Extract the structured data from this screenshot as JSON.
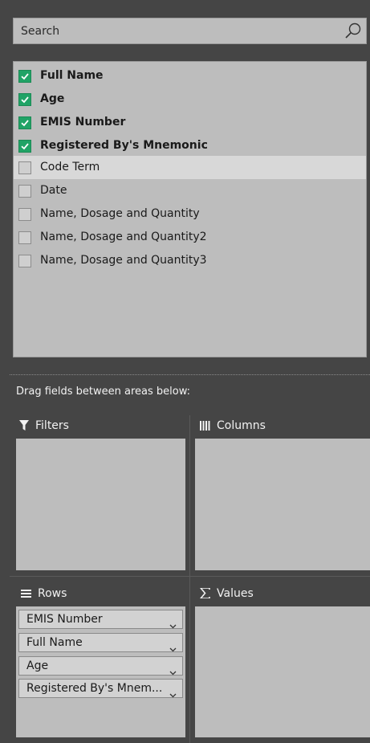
{
  "search": {
    "placeholder": "Search"
  },
  "fields": [
    {
      "label": "Full Name",
      "checked": true
    },
    {
      "label": "Age",
      "checked": true
    },
    {
      "label": "EMIS Number",
      "checked": true
    },
    {
      "label": "Registered By's Mnemonic",
      "checked": true
    },
    {
      "label": "Code Term",
      "checked": false
    },
    {
      "label": "Date",
      "checked": false
    },
    {
      "label": "Name, Dosage and Quantity",
      "checked": false
    },
    {
      "label": "Name, Dosage and Quantity2",
      "checked": false
    },
    {
      "label": "Name, Dosage and Quantity3",
      "checked": false
    }
  ],
  "drag_caption": "Drag fields between areas below:",
  "areas": {
    "filters": {
      "label": "Filters",
      "icon": "filter-icon"
    },
    "columns": {
      "label": "Columns",
      "icon": "columns-icon"
    },
    "rows": {
      "label": "Rows",
      "icon": "rows-icon",
      "items": [
        "EMIS Number",
        "Full Name",
        "Age",
        "Registered By's Mnem..."
      ]
    },
    "values": {
      "label": "Values",
      "icon": "sigma-icon"
    }
  },
  "colors": {
    "panel_bg": "#454545",
    "list_bg": "#bdbdbd",
    "check_green": "#21a366"
  }
}
